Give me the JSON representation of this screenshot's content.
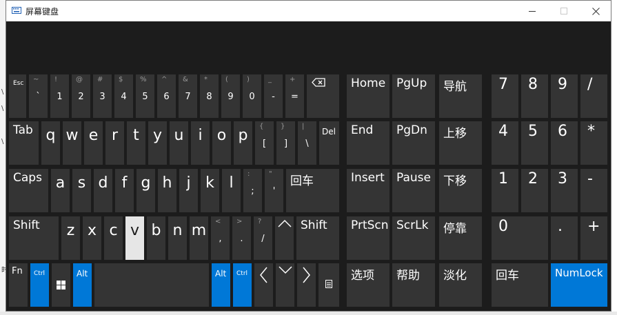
{
  "window": {
    "title": "屏幕键盘",
    "accent": "#0078d7"
  },
  "numbers_row": {
    "esc": "Esc",
    "keys": [
      {
        "shift": "~",
        "main": "`"
      },
      {
        "shift": "!",
        "main": "1"
      },
      {
        "shift": "@",
        "main": "2"
      },
      {
        "shift": "#",
        "main": "3"
      },
      {
        "shift": "$",
        "main": "4"
      },
      {
        "shift": "%",
        "main": "5"
      },
      {
        "shift": "^",
        "main": "6"
      },
      {
        "shift": "&",
        "main": "7"
      },
      {
        "shift": "*",
        "main": "8"
      },
      {
        "shift": "(",
        "main": "9"
      },
      {
        "shift": ")",
        "main": "0"
      },
      {
        "shift": "_",
        "main": "-"
      },
      {
        "shift": "+",
        "main": "="
      }
    ],
    "backspace_icon": "backspace-icon"
  },
  "qwerty_row": {
    "tab": "Tab",
    "letters": [
      "q",
      "w",
      "e",
      "r",
      "t",
      "y",
      "u",
      "i",
      "o",
      "p"
    ],
    "brackets": [
      {
        "shift": "{",
        "main": "["
      },
      {
        "shift": "}",
        "main": "]"
      },
      {
        "shift": "|",
        "main": "\\"
      }
    ],
    "del": "Del"
  },
  "home_row": {
    "caps": "Caps",
    "letters": [
      "a",
      "s",
      "d",
      "f",
      "g",
      "h",
      "j",
      "k",
      "l"
    ],
    "punct": [
      {
        "shift": ":",
        "main": ";"
      },
      {
        "shift": "\"",
        "main": "'"
      }
    ],
    "enter": "回车"
  },
  "shift_row": {
    "left_shift": "Shift",
    "letters": [
      "z",
      "x",
      "c",
      "v",
      "b",
      "n",
      "m"
    ],
    "pressed_letter": "v",
    "punct": [
      {
        "shift": "<",
        "main": ","
      },
      {
        "shift": ">",
        "main": "."
      },
      {
        "shift": "?",
        "main": "/"
      }
    ],
    "up_icon": "arrow-up-icon",
    "right_shift": "Shift"
  },
  "bottom_row": {
    "fn": "Fn",
    "ctrl_left": "Ctrl",
    "win_icon": "windows-logo-icon",
    "alt_left": "Alt",
    "alt_right": "Alt",
    "ctrl_right": "Ctrl",
    "left_icon": "arrow-left-icon",
    "down_icon": "arrow-down-icon",
    "right_icon": "arrow-right-icon",
    "menu_icon": "context-menu-icon"
  },
  "nav_keys": {
    "row1": [
      "Home",
      "PgUp",
      "导航"
    ],
    "row2": [
      "End",
      "PgDn",
      "上移"
    ],
    "row3": [
      "Insert",
      "Pause",
      "下移"
    ],
    "row4": [
      "PrtScn",
      "ScrLk",
      "停靠"
    ],
    "row5": [
      "选项",
      "帮助",
      "淡化"
    ]
  },
  "numpad": {
    "row1": [
      "7",
      "8",
      "9",
      "/"
    ],
    "row2": [
      "4",
      "5",
      "6",
      "*"
    ],
    "row3": [
      "1",
      "2",
      "3",
      "-"
    ],
    "row4": [
      "0",
      ".",
      "+"
    ],
    "enter": "回车",
    "numlock": "NumLock"
  }
}
